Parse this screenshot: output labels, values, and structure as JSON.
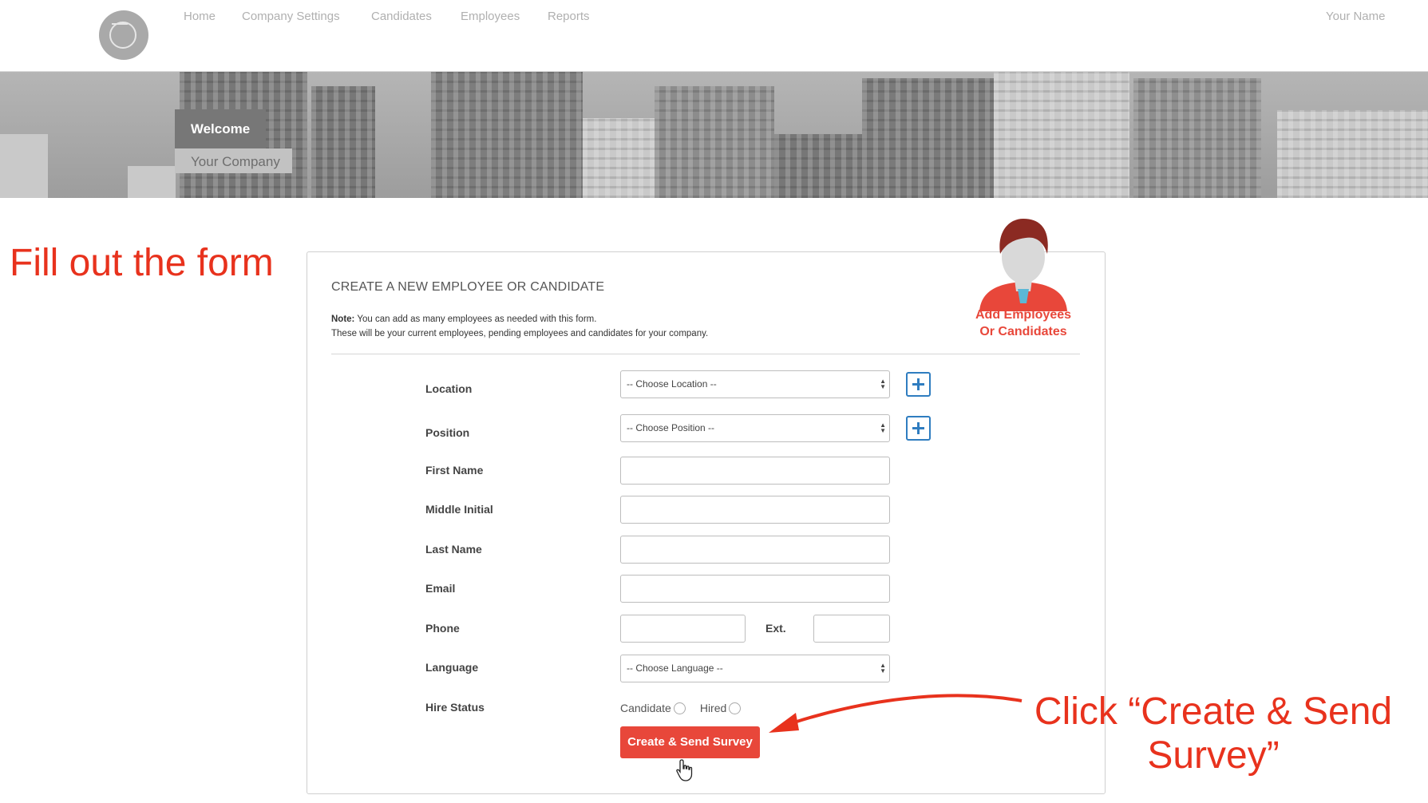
{
  "nav": {
    "items": [
      "Home",
      "Company Settings",
      "Candidates",
      "Employees",
      "Reports"
    ],
    "user": "Your Name"
  },
  "banner": {
    "welcome": "Welcome",
    "company": "Your Company"
  },
  "annotations": {
    "left": "Fill out the form",
    "right": "Click “Create & Send Survey”"
  },
  "form": {
    "title": "CREATE A NEW EMPLOYEE OR CANDIDATE",
    "note_label": "Note:",
    "note_line1": "You can add as many employees as needed with this form.",
    "note_line2": "These will be your current employees, pending employees and candidates for your company.",
    "avatar_caption_1": "Add Employees",
    "avatar_caption_2": "Or Candidates",
    "location_label": "Location",
    "location_value": "-- Choose Location --",
    "position_label": "Position",
    "position_value": "-- Choose Position --",
    "first_name_label": "First Name",
    "middle_initial_label": "Middle Initial",
    "last_name_label": "Last Name",
    "email_label": "Email",
    "phone_label": "Phone",
    "ext_label": "Ext.",
    "language_label": "Language",
    "language_value": "-- Choose Language --",
    "hire_status_label": "Hire Status",
    "candidate_option": "Candidate",
    "hired_option": "Hired",
    "submit_label": "Create & Send Survey"
  },
  "colors": {
    "accent_red": "#e8473a",
    "plus_blue": "#2f7dc0"
  },
  "icons": {
    "logo": "logo-icon",
    "add": "plus-square-icon",
    "cursor": "hand-pointer-icon",
    "avatar": "person-avatar-icon"
  }
}
